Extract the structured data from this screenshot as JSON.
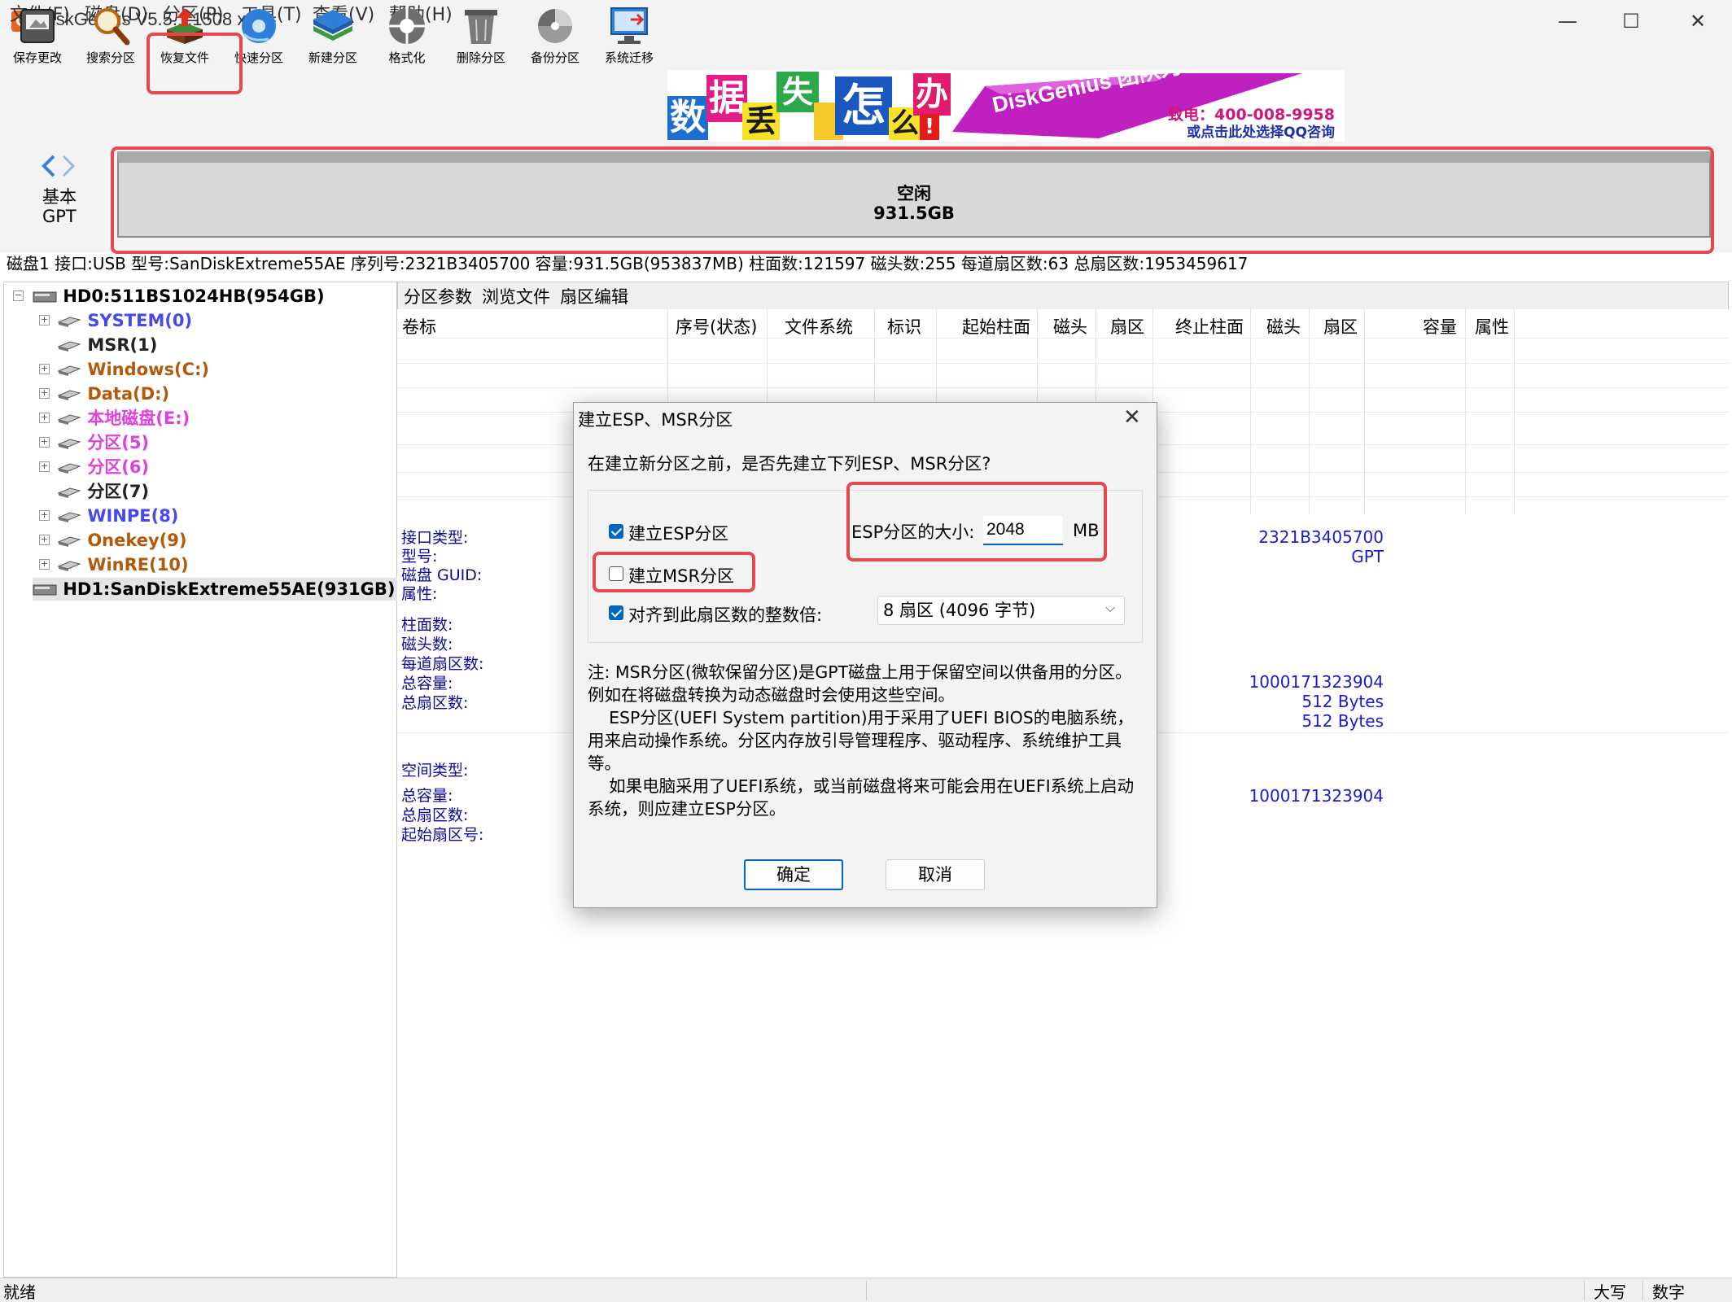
{
  "app": {
    "title": "DiskGenius V5.5.1.1508 x64",
    "icon_letter": "G"
  },
  "window_controls": {
    "minimize": "—",
    "maximize": "☐",
    "close": "✕"
  },
  "menu": [
    "文件(F)",
    "磁盘(D)",
    "分区(P)",
    "工具(T)",
    "查看(V)",
    "帮助(H)"
  ],
  "toolbar": [
    {
      "label": "保存更改",
      "icon": "save-icon"
    },
    {
      "label": "搜索分区",
      "icon": "search-icon"
    },
    {
      "label": "恢复文件",
      "icon": "recover-icon"
    },
    {
      "label": "快速分区",
      "icon": "quick-partition-icon"
    },
    {
      "label": "新建分区",
      "icon": "new-partition-icon"
    },
    {
      "label": "格式化",
      "icon": "format-icon"
    },
    {
      "label": "删除分区",
      "icon": "delete-icon"
    },
    {
      "label": "备份分区",
      "icon": "backup-icon"
    },
    {
      "label": "系统迁移",
      "icon": "migrate-icon"
    }
  ],
  "banner": {
    "chars": [
      "数",
      "据",
      "丢",
      "失",
      "怎",
      "么",
      "办",
      "!"
    ],
    "slogan": "DiskGenius 团队为您服务",
    "phone": "致电：400-008-9958",
    "qq": "或点击此处选择QQ咨询"
  },
  "diskmap": {
    "basic": "基本",
    "gpt": "GPT",
    "free_label": "空闲",
    "free_size": "931.5GB"
  },
  "disk_info": "磁盘1 接口:USB  型号:SanDiskExtreme55AE  序列号:2321B3405700  容量:931.5GB(953837MB)  柱面数:121597  磁头数:255  每道扇区数:63  总扇区数:1953459617",
  "tree": {
    "disk0": "HD0:511BS1024HB(954GB)",
    "partitions": [
      {
        "label": "SYSTEM(0)",
        "color": "#4848f0"
      },
      {
        "label": "MSR(1)",
        "color": "#222222"
      },
      {
        "label": "Windows(C:)",
        "color": "#b4580a"
      },
      {
        "label": "Data(D:)",
        "color": "#b4580a"
      },
      {
        "label": "本地磁盘(E:)",
        "color": "#e040e0"
      },
      {
        "label": "分区(5)",
        "color": "#e040e0"
      },
      {
        "label": "分区(6)",
        "color": "#e040e0"
      },
      {
        "label": "分区(7)",
        "color": "#222222"
      },
      {
        "label": "WINPE(8)",
        "color": "#4848f0"
      },
      {
        "label": "Onekey(9)",
        "color": "#b4580a"
      },
      {
        "label": "WinRE(10)",
        "color": "#b4580a"
      }
    ],
    "disk1": "HD1:SanDiskExtreme55AE(931GB)"
  },
  "tabs": [
    "分区参数",
    "浏览文件",
    "扇区编辑"
  ],
  "columns": [
    "卷标",
    "序号(状态)",
    "文件系统",
    "标识",
    "起始柱面",
    "磁头",
    "扇区",
    "终止柱面",
    "磁头",
    "扇区",
    "容量",
    "属性"
  ],
  "details": {
    "labels_a": [
      "接口类型:",
      "型号:",
      "磁盘 GUID:",
      "属性:"
    ],
    "labels_b": [
      "柱面数:",
      "磁头数:",
      "每道扇区数:",
      "总容量:",
      "总扇区数:"
    ],
    "labels_c": [
      "空间类型:"
    ],
    "labels_d": [
      "总容量:",
      "总扇区数:",
      "起始扇区号:"
    ],
    "values_a": [
      "2321B3405700",
      "GPT"
    ],
    "values_b": [
      "1000171323904",
      "512 Bytes",
      "512 Bytes"
    ],
    "values_d": [
      "1000171323904"
    ]
  },
  "status": {
    "left": "就绪",
    "caps": "大写",
    "num": "数字"
  },
  "dialog": {
    "title": "建立ESP、MSR分区",
    "close": "✕",
    "prompt": "在建立新分区之前，是否先建立下列ESP、MSR分区?",
    "esp_checkbox": "建立ESP分区",
    "esp_checked": true,
    "esp_size_label": "ESP分区的大小:",
    "esp_size_value": "2048",
    "esp_size_unit": "MB",
    "msr_checkbox": "建立MSR分区",
    "msr_checked": false,
    "align_checkbox": "对齐到此扇区数的整数倍:",
    "align_checked": true,
    "align_value": "8 扇区 (4096 字节)",
    "notes": [
      "注: MSR分区(微软保留分区)是GPT磁盘上用于保留空间以供备用的分区。",
      "例如在将磁盘转换为动态磁盘时会使用这些空间。",
      "    ESP分区(UEFI System partition)用于采用了UEFI BIOS的电脑系统，",
      "用来启动操作系统。分区内存放引导管理程序、驱动程序、系统维护工具",
      "等。",
      "    如果电脑采用了UEFI系统，或当前磁盘将来可能会用在UEFI系统上启动",
      "系统，则应建立ESP分区。"
    ],
    "ok": "确定",
    "cancel": "取消"
  },
  "colors": {
    "accent": "#0067c0",
    "highlight": "#e5484d",
    "detail_label": "#0a0a9b",
    "detail_value": "#1a1ad1"
  }
}
